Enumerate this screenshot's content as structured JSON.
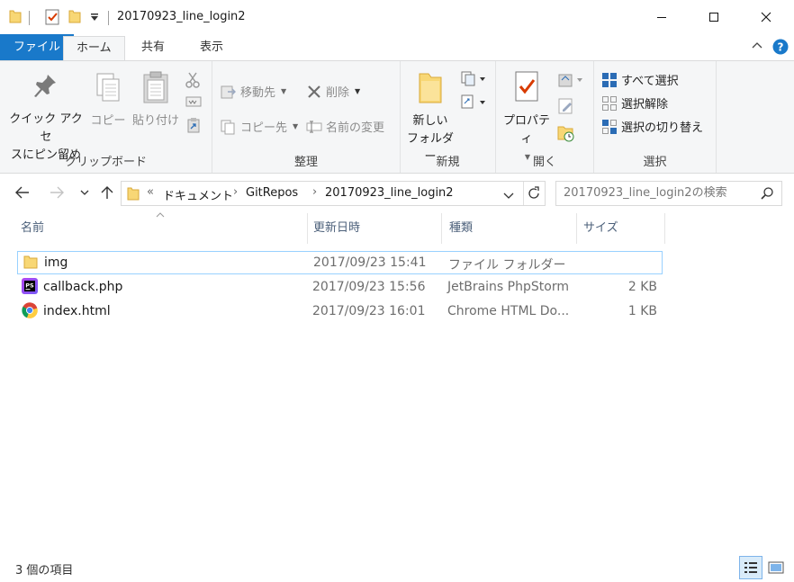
{
  "window": {
    "title": "20170923_line_login2",
    "minimize_icon": "minimize-icon",
    "maximize_icon": "maximize-icon",
    "close_icon": "close-icon"
  },
  "tabs": [
    {
      "label": "ファイル"
    },
    {
      "label": "ホーム"
    },
    {
      "label": "共有"
    },
    {
      "label": "表示"
    }
  ],
  "ribbon": {
    "clipboard": {
      "group_label": "クリップボード",
      "pin_line1": "クイック アクセ",
      "pin_line2": "スにピン留め",
      "copy": "コピー",
      "paste": "貼り付け"
    },
    "organize": {
      "group_label": "整理",
      "move_to": "移動先",
      "copy_to": "コピー先",
      "delete": "削除",
      "rename": "名前の変更"
    },
    "new": {
      "group_label": "新規",
      "new_folder_line1": "新しい",
      "new_folder_line2": "フォルダー"
    },
    "open": {
      "group_label": "開く",
      "properties": "プロパティ"
    },
    "select": {
      "group_label": "選択",
      "select_all": "すべて選択",
      "select_none": "選択解除",
      "invert": "選択の切り替え"
    }
  },
  "address": {
    "overflow": "«",
    "crumbs": [
      "ドキュメント",
      "GitRepos",
      "20170923_line_login2"
    ],
    "search_placeholder": "20170923_line_login2の検索"
  },
  "columns": {
    "name": "名前",
    "modified": "更新日時",
    "type": "種類",
    "size": "サイズ"
  },
  "files": [
    {
      "name": "img",
      "modified": "2017/09/23 15:41",
      "type": "ファイル フォルダー",
      "size": "",
      "icon": "folder-icon"
    },
    {
      "name": "callback.php",
      "modified": "2017/09/23 15:56",
      "type": "JetBrains PhpStorm",
      "size": "2 KB",
      "icon": "phpstorm-icon"
    },
    {
      "name": "index.html",
      "modified": "2017/09/23 16:01",
      "type": "Chrome HTML Do...",
      "size": "1 KB",
      "icon": "chrome-icon"
    }
  ],
  "status": {
    "item_count": "3 個の項目"
  },
  "colors": {
    "accent": "#1979ca",
    "folder": "#f8d775",
    "selection_border": "#99d1ff"
  }
}
